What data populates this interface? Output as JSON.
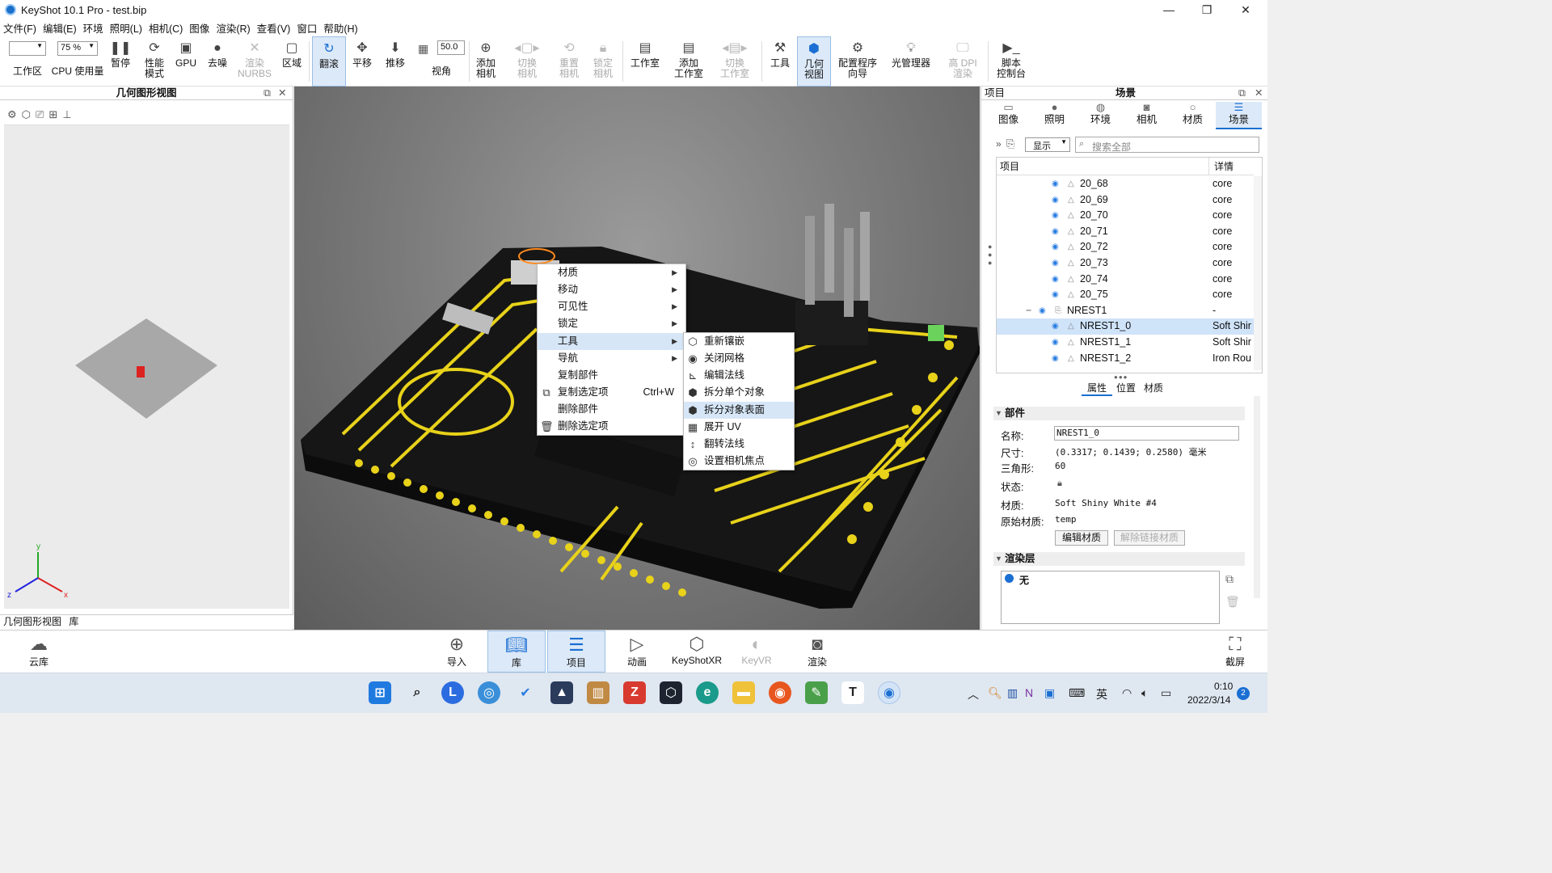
{
  "window": {
    "title": "KeyShot 10.1 Pro  - test.bip"
  },
  "menu": [
    "文件(F)",
    "编辑(E)",
    "环境",
    "照明(L)",
    "相机(C)",
    "图像",
    "渲染(R)",
    "查看(V)",
    "窗口",
    "帮助(H)"
  ],
  "toolbar": {
    "workspace_label": "工作区",
    "cpu_percent": "75 %",
    "cpu_label": "CPU 使用量",
    "pause": "暂停",
    "perf1": "性能",
    "perf2": "模式",
    "gpu": "GPU",
    "denoise": "去噪",
    "nurbs1": "渲染",
    "nurbs2": "NURBS",
    "region": "区域",
    "tumble": "翻滚",
    "pan": "平移",
    "dolly": "推移",
    "fov_value": "50.0",
    "fov": "视角",
    "add_cam1": "添加",
    "add_cam2": "相机",
    "switch_cam1": "切换",
    "switch_cam2": "相机",
    "reset_cam1": "重置",
    "reset_cam2": "相机",
    "lock_cam1": "锁定",
    "lock_cam2": "相机",
    "studio": "工作室",
    "add_studio1": "添加",
    "add_studio2": "工作室",
    "switch_studio1": "切换",
    "switch_studio2": "工作室",
    "tools": "工具",
    "geo_view1": "几何",
    "geo_view2": "视图",
    "config1": "配置程序",
    "config2": "向导",
    "light_mgr": "光管理器",
    "hidpi1": "高 DPI",
    "hidpi2": "渲染",
    "script1": "脚本",
    "script2": "控制台"
  },
  "left_panel": {
    "title": "几何图形视图",
    "tab_geo": "几何图形视图",
    "tab_lib": "库",
    "axis_x": "x",
    "axis_y": "y",
    "axis_z": "z"
  },
  "context_menu": {
    "items": [
      {
        "label": "材质",
        "submenu": true
      },
      {
        "label": "移动",
        "submenu": true
      },
      {
        "label": "可见性",
        "submenu": true
      },
      {
        "label": "锁定",
        "submenu": true
      },
      {
        "label": "工具",
        "submenu": true
      },
      {
        "label": "导航",
        "submenu": true
      },
      {
        "label": "复制部件"
      },
      {
        "label": "复制选定项",
        "shortcut": "Ctrl+W"
      },
      {
        "label": "删除部件"
      },
      {
        "label": "删除选定项"
      }
    ],
    "tools_submenu": [
      "重新镶嵌",
      "关闭网格",
      "编辑法线",
      "拆分单个对象",
      "拆分对象表面",
      "展开 UV",
      "翻转法线",
      "设置相机焦点"
    ]
  },
  "right_panel": {
    "project_label": "项目",
    "scene_title": "场景",
    "tabs": [
      "图像",
      "照明",
      "环境",
      "相机",
      "材质",
      "场景"
    ],
    "display_option": "显示",
    "search_placeholder": "搜索全部",
    "col_item": "项目",
    "col_detail": "详情",
    "rows": [
      {
        "name": "20_68",
        "detail": "core"
      },
      {
        "name": "20_69",
        "detail": "core"
      },
      {
        "name": "20_70",
        "detail": "core"
      },
      {
        "name": "20_71",
        "detail": "core"
      },
      {
        "name": "20_72",
        "detail": "core"
      },
      {
        "name": "20_73",
        "detail": "core"
      },
      {
        "name": "20_74",
        "detail": "core"
      },
      {
        "name": "20_75",
        "detail": "core"
      },
      {
        "name": "NREST1",
        "detail": "-"
      },
      {
        "name": "NREST1_0",
        "detail": "Soft Shir"
      },
      {
        "name": "NREST1_1",
        "detail": "Soft Shir"
      },
      {
        "name": "NREST1_2",
        "detail": "Iron Rou"
      }
    ],
    "subtabs": [
      "属性",
      "位置",
      "材质"
    ],
    "part_section": "部件",
    "name_label": "名称:",
    "name_value": "NREST1_0",
    "size_label": "尺寸:",
    "size_value": "(0.3317; 0.1439; 0.2580) 毫米",
    "tri_label": "三角形:",
    "tri_value": "60",
    "state_label": "状态:",
    "material_label": "材质:",
    "material_value": "Soft Shiny White #4",
    "orig_material_label": "原始材质:",
    "orig_material_value": "temp",
    "edit_material": "编辑材质",
    "unlink_material": "解除链接材质",
    "render_layer_section": "渲染层",
    "render_layer_none": "无"
  },
  "bottom_bar": {
    "cloud": "云库",
    "import": "导入",
    "library": "库",
    "project": "项目",
    "animation": "动画",
    "keyshotxr": "KeyShotXR",
    "keyvr": "KeyVR",
    "render": "渲染",
    "screenshot": "截屏"
  },
  "taskbar": {
    "ime": "英",
    "time": "0:10",
    "date": "2022/3/14",
    "notif": "2"
  }
}
